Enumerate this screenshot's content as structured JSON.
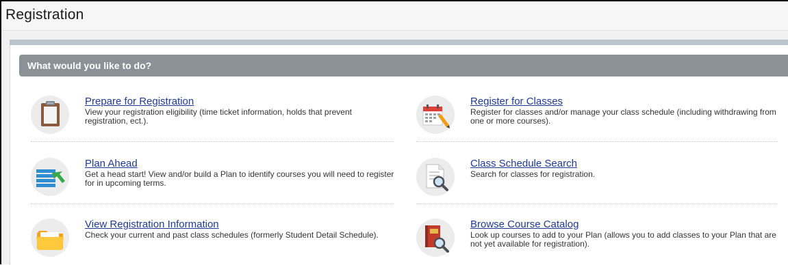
{
  "header": {
    "title": "Registration"
  },
  "panel": {
    "title": "What would you like to do?"
  },
  "items": [
    {
      "title": "Prepare for Registration",
      "description": "View your registration eligibility (time ticket information, holds that prevent registration, ect.).",
      "icon": "clipboard-icon"
    },
    {
      "title": "Plan Ahead",
      "description": "Get a head start! View and/or build a Plan to identify courses you will need to register for in upcoming terms.",
      "icon": "plan-list-icon"
    },
    {
      "title": "View Registration Information",
      "description": "Check your current and past class schedules (formerly Student Detail Schedule).",
      "icon": "folder-icon"
    },
    {
      "title": "Register for Classes",
      "description": "Register for classes and/or manage your class schedule (including withdrawing from one or more courses).",
      "icon": "calendar-pencil-icon"
    },
    {
      "title": "Class Schedule Search",
      "description": "Search for classes for registration.",
      "icon": "document-search-icon"
    },
    {
      "title": "Browse Course Catalog",
      "description": "Look up courses to add to your Plan (allows you to add classes to your Plan that are not yet available for registration).",
      "icon": "book-search-icon"
    }
  ],
  "colors": {
    "link": "#1f3a93",
    "panel_title_bg": "#8a9297",
    "panel_strip": "#b9c4cc"
  }
}
